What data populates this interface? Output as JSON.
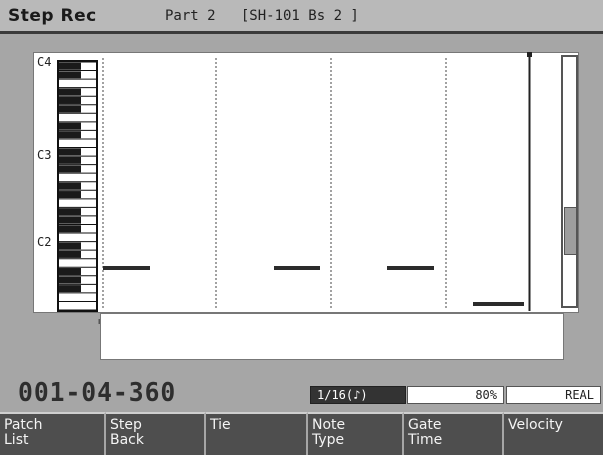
{
  "header": {
    "title": "Step Rec",
    "subtitle": "Part 2   [SH-101 Bs 2 ]"
  },
  "piano_roll": {
    "octave_labels": [
      "C4",
      "C3",
      "C2"
    ],
    "notes": [
      {
        "step": 1,
        "pitch": "C2"
      },
      {
        "step": 2,
        "pitch": "C2"
      },
      {
        "step": 3,
        "pitch": "C2"
      },
      {
        "step": 4,
        "pitch": "C1"
      }
    ]
  },
  "status": {
    "position": "001-04-360",
    "note_type": "1/16(♪)",
    "gate_time": "80%",
    "input_mode": "REAL"
  },
  "function_keys": [
    {
      "line1": "Patch",
      "line2": "List"
    },
    {
      "line1": "Step",
      "line2": "Back"
    },
    {
      "line1": "Tie",
      "line2": ""
    },
    {
      "line1": "Note",
      "line2": "Type"
    },
    {
      "line1": "Gate",
      "line2": "Time"
    },
    {
      "line1": "Velocity",
      "line2": ""
    }
  ],
  "colors": {
    "background": "#a6a6a6",
    "header": "#b9b9b9",
    "fkey": "#4e4e4e",
    "note": "#2b2b2b"
  }
}
